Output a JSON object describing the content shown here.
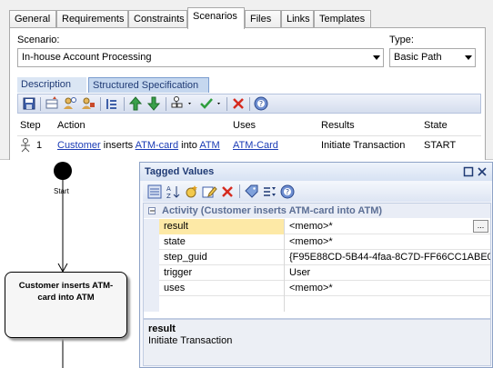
{
  "tabs": [
    "General",
    "Requirements",
    "Constraints",
    "Scenarios",
    "Files",
    "Links",
    "Templates"
  ],
  "scenario": {
    "label": "Scenario:",
    "value": "In-house Account Processing",
    "type_label": "Type:",
    "type_value": "Basic Path"
  },
  "subtabs": [
    "Description",
    "Structured Specification"
  ],
  "grid": {
    "columns": [
      "Step",
      "Action",
      "Uses",
      "Results",
      "State"
    ],
    "row": {
      "step": "1",
      "action_link1": "Customer",
      "action_text1": " inserts ",
      "action_link2": "ATM-card",
      "action_text2": " into ",
      "action_link3": "ATM",
      "uses": "ATM-Card",
      "results": "Initiate Transaction",
      "state": "START"
    }
  },
  "diagram": {
    "start_label": "Start",
    "activity_label": "Customer inserts ATM-card into ATM"
  },
  "tagged_values": {
    "title": "Tagged Values",
    "group": "Activity (Customer inserts ATM-card into ATM)",
    "rows": [
      {
        "key": "result",
        "value": "<memo>*"
      },
      {
        "key": "state",
        "value": "<memo>*"
      },
      {
        "key": "step_guid",
        "value": "{F95E88CD-5B44-4faa-8C7D-FF66CC1ABE0..."
      },
      {
        "key": "trigger",
        "value": "User"
      },
      {
        "key": "uses",
        "value": "<memo>*"
      }
    ],
    "ellipsis": "...",
    "desc_title": "result",
    "desc_text": "Initiate Transaction"
  },
  "colors": {
    "accent": "#1f3a74",
    "link": "#1a3bb5",
    "selected_key_bg": "#fde9a6"
  }
}
